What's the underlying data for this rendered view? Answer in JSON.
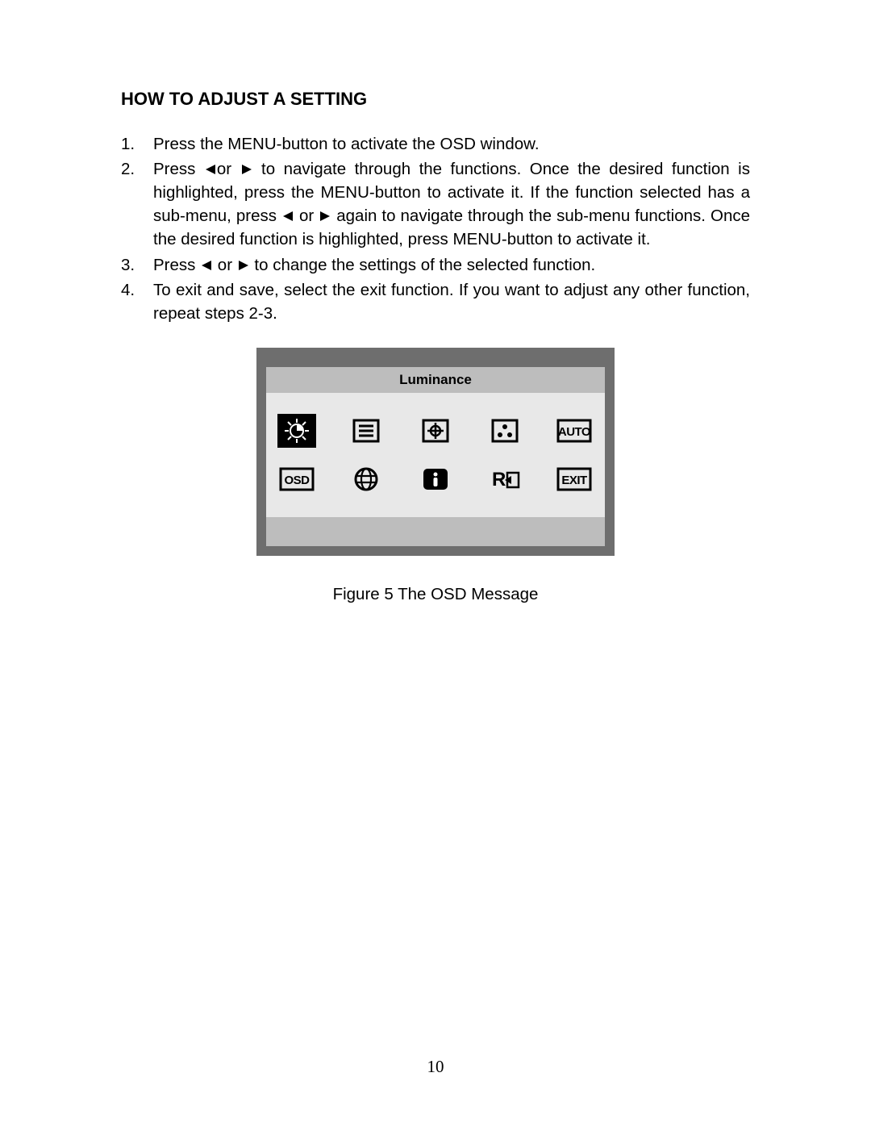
{
  "title": "HOW TO ADJUST A SETTING",
  "steps": [
    {
      "num": "1.",
      "pre": "Press the MENU-button to activate the OSD window."
    },
    {
      "num": "2.",
      "parts": {
        "a": "Press ",
        "b": "or ",
        "c": " to navigate through the functions. Once the desired function is highlighted, press the MENU-button  to activate it.  If the function selected has a sub-menu, press ",
        "d": " or ",
        "e": " again to navigate through the sub-menu functions.   Once the desired function is highlighted, press MENU-button to activate it."
      }
    },
    {
      "num": "3.",
      "parts": {
        "a": "Press ",
        "b": " or ",
        "c": " to change the settings of the selected function."
      }
    },
    {
      "num": "4.",
      "pre": "To exit and save, select the exit function. If you want to adjust any other function, repeat steps 2-3."
    }
  ],
  "osd": {
    "header": "Luminance",
    "labels": {
      "osd": "OSD",
      "auto": "AUTO",
      "exit": "EXIT"
    }
  },
  "caption": "Figure 5    The  OSD  Message",
  "page_number": "10"
}
